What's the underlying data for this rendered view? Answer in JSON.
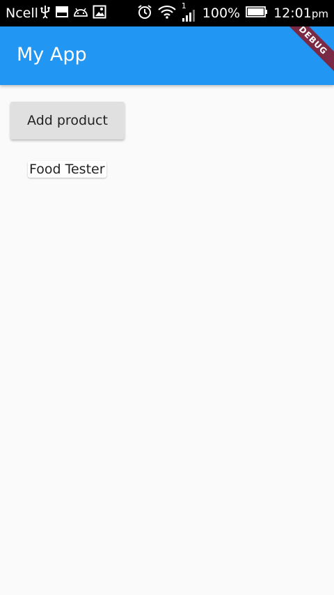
{
  "status_bar": {
    "carrier": "Ncell",
    "battery_percent": "100%",
    "time": "12:01",
    "time_suffix": "pm",
    "left_icons": [
      "usb-icon",
      "image-icon",
      "android-icon",
      "photo-icon"
    ],
    "right_icons": [
      "alarm-icon",
      "wifi-icon",
      "signal-icon",
      "battery-icon"
    ],
    "signal_label": "1"
  },
  "app_bar": {
    "title": "My App",
    "color": "#2196f3",
    "debug_banner": "DEBUG"
  },
  "main": {
    "add_button_label": "Add product",
    "products": [
      {
        "name": "Food Tester"
      }
    ]
  }
}
